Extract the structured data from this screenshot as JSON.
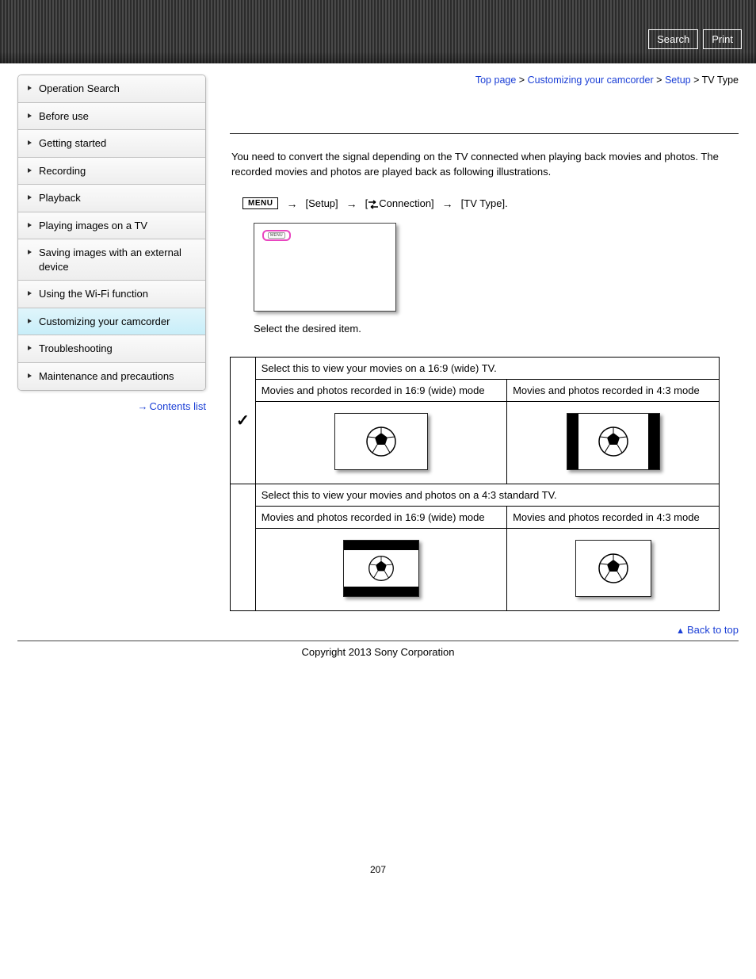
{
  "header": {
    "search": "Search",
    "print": "Print"
  },
  "breadcrumb": {
    "top": "Top page",
    "l1": "Customizing your camcorder",
    "l2": "Setup",
    "current": "TV Type",
    "sep": ">"
  },
  "sidebar": {
    "items": [
      "Operation Search",
      "Before use",
      "Getting started",
      "Recording",
      "Playback",
      "Playing images on a TV",
      "Saving images with an external device",
      "Using the Wi-Fi function",
      "Customizing your camcorder",
      "Troubleshooting",
      "Maintenance and precautions"
    ],
    "active_index": 8,
    "contents_list": "Contents list"
  },
  "content": {
    "intro": "You need to convert the signal depending on the TV connected when playing back movies and photos. The recorded movies and photos are played back as following illustrations.",
    "menu_label": "MENU",
    "step1": "[Setup]",
    "step2_open": "[",
    "step2_close": "Connection]",
    "step3": "[TV Type].",
    "select_desired": "Select the desired item.",
    "row1_header": "Select this to view your movies on a 16:9 (wide) TV.",
    "row2_header": "Select this to view your movies and photos on a 4:3 standard TV.",
    "col16_9": "Movies and photos recorded in 16:9 (wide) mode",
    "col4_3": "Movies and photos recorded in 4:3 mode",
    "check": "✓"
  },
  "footer": {
    "backtop": "Back to top",
    "copyright": "Copyright 2013 Sony Corporation",
    "page": "207"
  }
}
